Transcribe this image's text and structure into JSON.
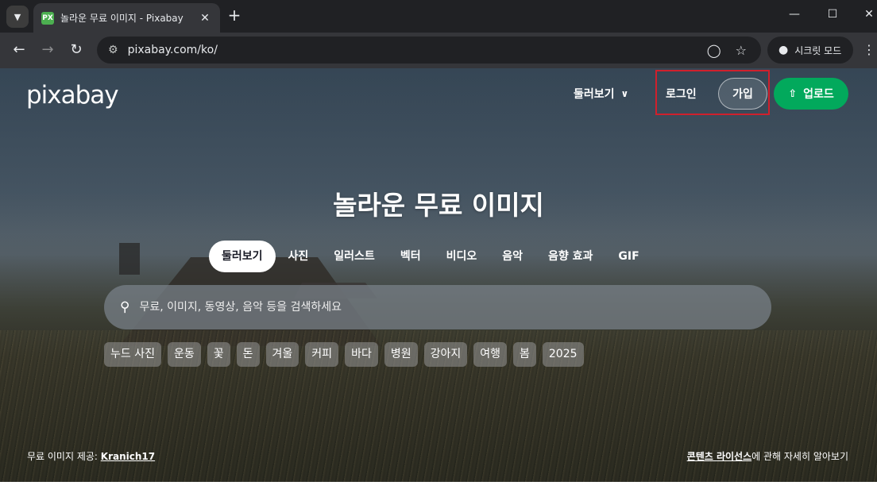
{
  "browser": {
    "tab_title": "놀라운 무료 이미지 - Pixabay",
    "favicon_text": "PX",
    "url": "pixabay.com/ko/",
    "incognito_label": "시크릿 모드"
  },
  "header": {
    "logo": "pixabay",
    "explore_label": "둘러보기",
    "login_label": "로그인",
    "signup_label": "가입",
    "upload_label": "업로드"
  },
  "hero": {
    "title": "놀라운 무료 이미지",
    "categories": [
      "둘러보기",
      "사진",
      "일러스트",
      "벡터",
      "비디오",
      "음악",
      "음향 효과",
      "GIF"
    ],
    "search_placeholder": "무료, 이미지, 동영상, 음악 등을 검색하세요",
    "tags": [
      "누드 사진",
      "운동",
      "꽃",
      "돈",
      "겨울",
      "커피",
      "바다",
      "병원",
      "강아지",
      "여행",
      "봄",
      "2025"
    ]
  },
  "footer": {
    "credit_prefix": "무료 이미지 제공: ",
    "credit_author": "Kranich17",
    "license_link": "콘텐츠 라이선스",
    "license_suffix": "에 관해 자세히 알아보기"
  },
  "colors": {
    "accent_green": "#02a95c",
    "highlight_red": "#d0202c"
  }
}
